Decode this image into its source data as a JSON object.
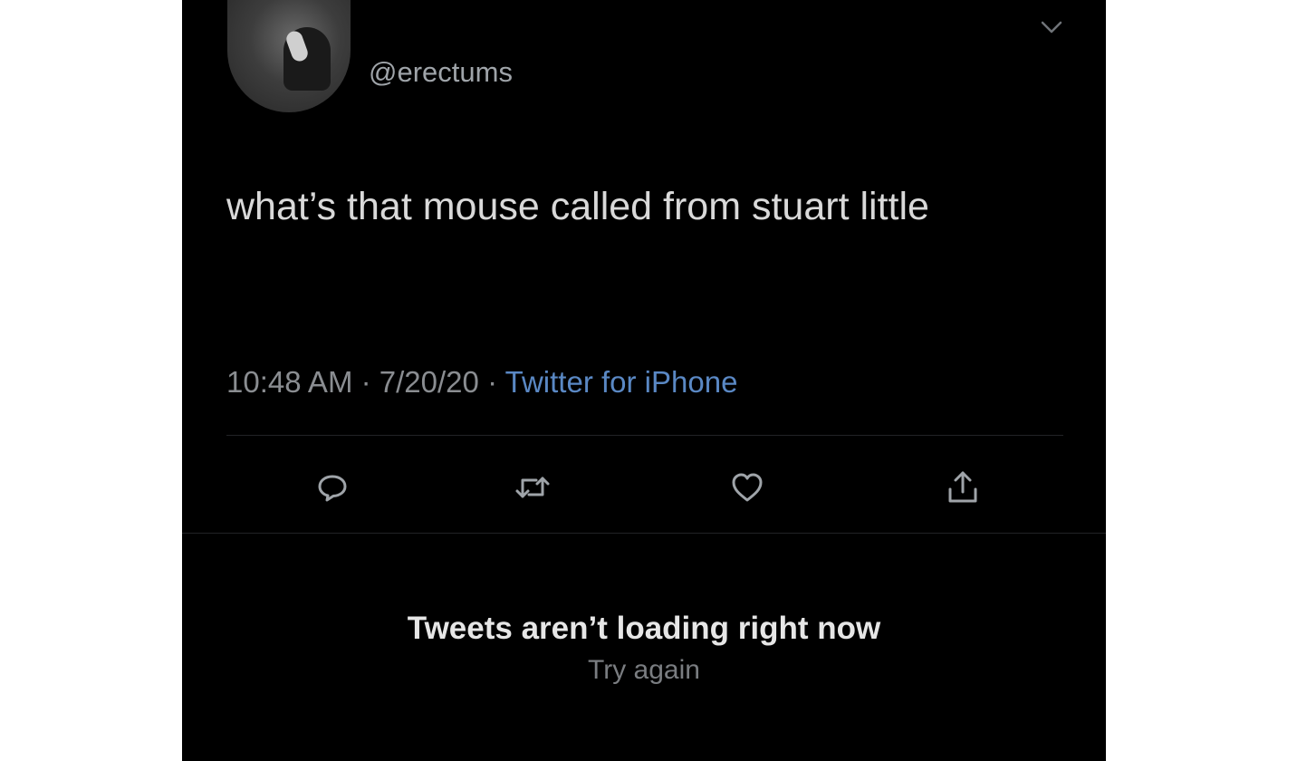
{
  "tweet": {
    "handle": "@erectums",
    "text": "what’s that mouse called from stuart little",
    "time": "10:48 AM",
    "separator": "·",
    "date": "7/20/20",
    "source": "Twitter for iPhone"
  },
  "actions": {
    "icons": [
      "reply-icon",
      "retweet-icon",
      "like-icon",
      "share-icon"
    ]
  },
  "error": {
    "title": "Tweets aren’t loading right now",
    "retry": "Try again"
  },
  "colors": {
    "background": "#000000",
    "text": "#d9d9d9",
    "muted": "#8a8d91",
    "link": "#5a88c4",
    "icon": "#9fa4a9"
  }
}
